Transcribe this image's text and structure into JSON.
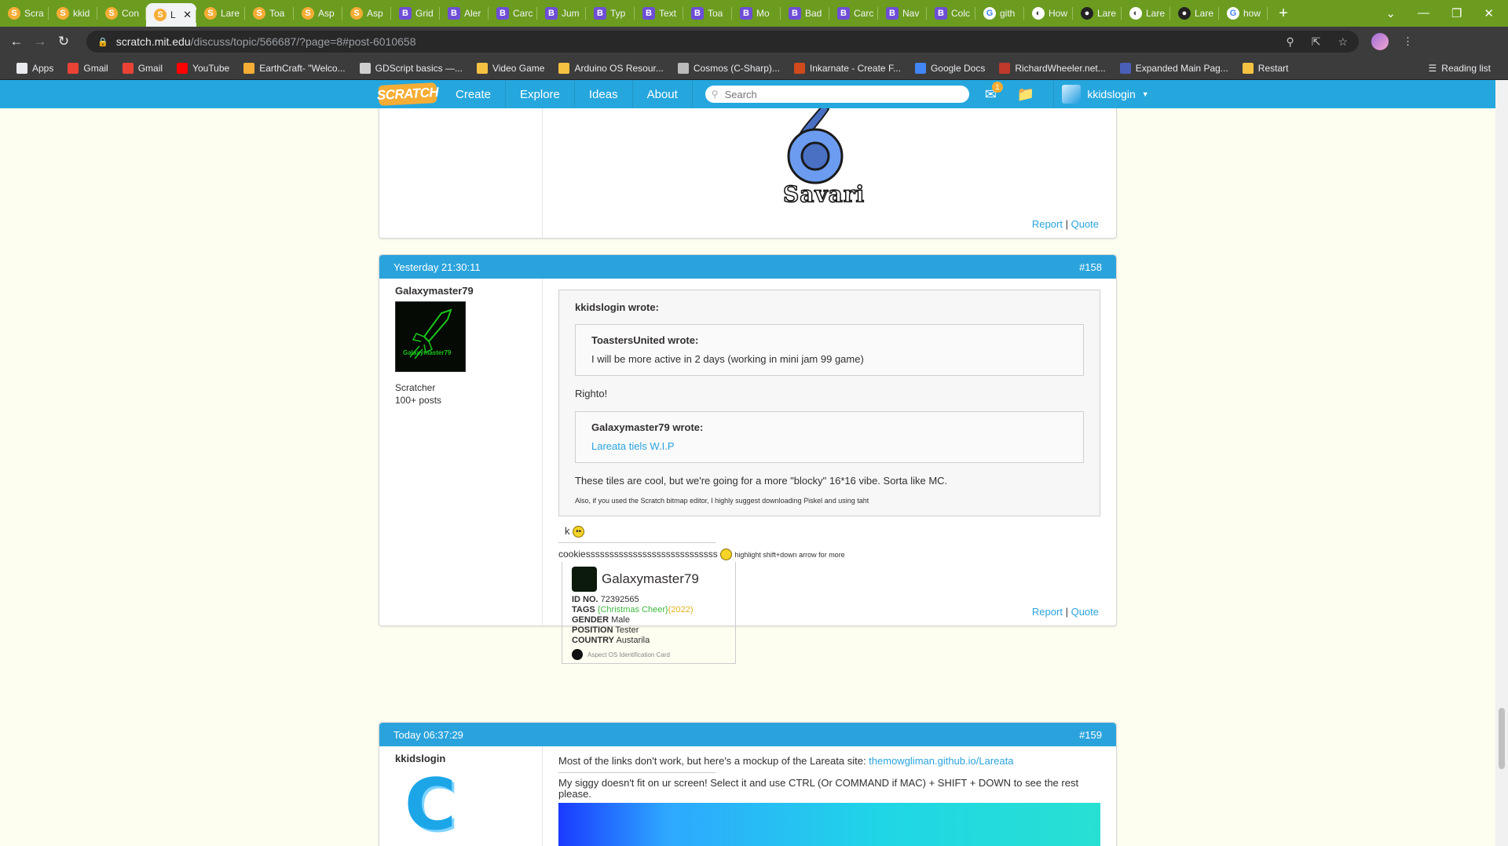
{
  "browser": {
    "tabs": [
      {
        "label": "Scra",
        "icon": "scratch-icon"
      },
      {
        "label": "kkid",
        "icon": "scratch-icon"
      },
      {
        "label": "Con",
        "icon": "scratch-icon"
      },
      {
        "label": "L",
        "icon": "scratch-icon",
        "active": true
      },
      {
        "label": "Lare",
        "icon": "scratch-icon"
      },
      {
        "label": "Toa",
        "icon": "scratch-icon"
      },
      {
        "label": "Asp",
        "icon": "scratch-icon"
      },
      {
        "label": "Asp",
        "icon": "scratch-icon"
      },
      {
        "label": "Grid",
        "icon": "bootstrap-icon"
      },
      {
        "label": "Aler",
        "icon": "bootstrap-icon"
      },
      {
        "label": "Carc",
        "icon": "bootstrap-icon"
      },
      {
        "label": "Jum",
        "icon": "bootstrap-icon"
      },
      {
        "label": "Typ",
        "icon": "bootstrap-icon"
      },
      {
        "label": "Text",
        "icon": "bootstrap-icon"
      },
      {
        "label": "Toa",
        "icon": "bootstrap-icon"
      },
      {
        "label": "Mo",
        "icon": "bootstrap-icon"
      },
      {
        "label": "Bad",
        "icon": "bootstrap-icon"
      },
      {
        "label": "Carc",
        "icon": "bootstrap-icon"
      },
      {
        "label": "Nav",
        "icon": "bootstrap-icon"
      },
      {
        "label": "Colc",
        "icon": "bootstrap-icon"
      },
      {
        "label": "gith",
        "icon": "google-icon"
      },
      {
        "label": "How",
        "icon": "globe-icon"
      },
      {
        "label": "Lare",
        "icon": "github-icon"
      },
      {
        "label": "Lare",
        "icon": "globe-icon"
      },
      {
        "label": "Lare",
        "icon": "github-icon"
      },
      {
        "label": "how",
        "icon": "google-icon"
      }
    ],
    "url_host": "scratch.mit.edu",
    "url_path": "/discuss/topic/566687/?page=8#post-6010658",
    "bookmarks": [
      {
        "label": "Apps",
        "color": "#e8eaed"
      },
      {
        "label": "Gmail",
        "color": "#ea4335"
      },
      {
        "label": "Gmail",
        "color": "#ea4335"
      },
      {
        "label": "YouTube",
        "color": "#ff0000"
      },
      {
        "label": "EarthCraft- \"Welco...",
        "color": "#f6ad35"
      },
      {
        "label": "GDScript basics —...",
        "color": "#cfcfcf"
      },
      {
        "label": "Video Game",
        "color": "#f6c242"
      },
      {
        "label": "Arduino OS Resour...",
        "color": "#f6c242"
      },
      {
        "label": "Cosmos (C-Sharp)...",
        "color": "#bbbbbb"
      },
      {
        "label": "Inkarnate - Create F...",
        "color": "#d04a1c"
      },
      {
        "label": "Google Docs",
        "color": "#4285f4"
      },
      {
        "label": "RichardWheeler.net...",
        "color": "#c0392b"
      },
      {
        "label": "Expanded Main Pag...",
        "color": "#4a5fb8"
      },
      {
        "label": "Restart",
        "color": "#f6c242"
      }
    ],
    "reading_list": "Reading list"
  },
  "scratch_nav": {
    "logo": "SCRATCH",
    "items": [
      "Create",
      "Explore",
      "Ideas",
      "About"
    ],
    "search_placeholder": "Search",
    "message_count": "1",
    "username": "kkidslogin"
  },
  "posts": [
    {
      "signature_logo_text": "Savari",
      "report": "Report",
      "quote": "Quote"
    },
    {
      "timestamp": "Yesterday 21:30:11",
      "number": "#158",
      "author": "Galaxymaster79",
      "rank": "Scratcher",
      "post_count": "100+ posts",
      "quote_outer_author": "kkidslogin wrote:",
      "quote_inner1_author": "ToastersUnited wrote:",
      "quote_inner1_text": "I will be more active in 2 days (working in mini jam 99 game)",
      "quote_reply1": "Righto!",
      "quote_inner2_author": "Galaxymaster79 wrote:",
      "quote_inner2_link": "Lareata tiels W.I.P",
      "quote_reply2": "These tiles are cool, but we're going for a more \"blocky\" 16*16 vibe. Sorta like MC.",
      "quote_reply3": "Also, if you used the Scratch bitmap editor, I highly suggest downloading Piskel and using taht",
      "body": "k",
      "sig_line": "cookiessssssssssssssssssssssssssss",
      "sig_hint": "highlight shift+down arrow for more",
      "card": {
        "name": "Galaxymaster79",
        "id_label": "ID NO.",
        "id": "72392565",
        "tags_label": "TAGS",
        "tag1": "{Christmas Cheer}",
        "tag2": "(2022)",
        "gender_label": "GENDER",
        "gender": "Male",
        "position_label": "POSITION",
        "position": "Tester",
        "country_label": "COUNTRY",
        "country": "Austarila",
        "footer": "Aspect OS Identification Card"
      },
      "report": "Report",
      "quote": "Quote"
    },
    {
      "timestamp": "Today 06:37:29",
      "number": "#159",
      "author": "kkidslogin",
      "text1": "Most of the links don't work, but here's a mockup of the Lareata site: ",
      "link1": "themowgliman.github.io/Lareata",
      "text2": "My siggy doesn't fit on ur screen! Select it and use CTRL (Or COMMAND if MAC) + SHIFT + DOWN to see the rest please."
    }
  ],
  "colors": {
    "scratch_blue": "#2aa3dc",
    "scratch_orange": "#f6ad35",
    "tabstrip": "#6b9c1f"
  }
}
